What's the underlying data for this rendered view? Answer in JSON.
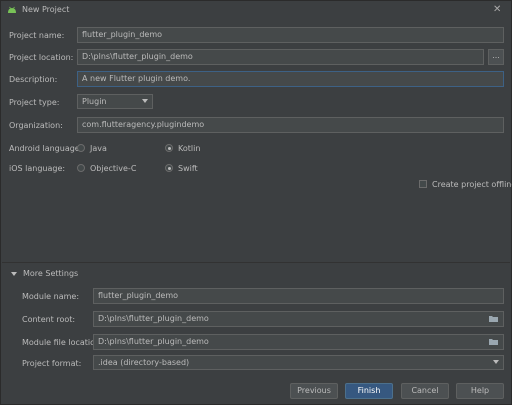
{
  "window": {
    "title": "New Project",
    "close_glyph": "✕",
    "icon": "android-icon",
    "accent": "#3d6185"
  },
  "form": {
    "project_name": {
      "label": "Project name:",
      "value": "flutter_plugin_demo"
    },
    "project_location": {
      "label": "Project location:",
      "value": "D:\\plns\\flutter_plugin_demo",
      "browse_label": "..."
    },
    "description": {
      "label": "Description:",
      "value": "A new Flutter plugin demo."
    },
    "project_type": {
      "label": "Project type:",
      "value": "Plugin"
    },
    "organization": {
      "label": "Organization:",
      "value": "com.flutteragency.plugindemo"
    },
    "android_language": {
      "label": "Android language:",
      "options": [
        "Java",
        "Kotlin"
      ],
      "selected": "Kotlin"
    },
    "ios_language": {
      "label": "iOS language:",
      "options": [
        "Objective-C",
        "Swift"
      ],
      "selected": "Swift"
    },
    "create_offline": {
      "label": "Create project offline",
      "checked": false
    }
  },
  "more_settings": {
    "label": "More Settings",
    "module_name": {
      "label": "Module name:",
      "value": "flutter_plugin_demo"
    },
    "content_root": {
      "label": "Content root:",
      "value": "D:\\plns\\flutter_plugin_demo"
    },
    "module_file_location": {
      "label": "Module file location:",
      "value": "D:\\plns\\flutter_plugin_demo"
    },
    "project_format": {
      "label": "Project format:",
      "value": ".idea (directory-based)"
    }
  },
  "buttons": {
    "previous": "Previous",
    "finish": "Finish",
    "cancel": "Cancel",
    "help": "Help"
  }
}
